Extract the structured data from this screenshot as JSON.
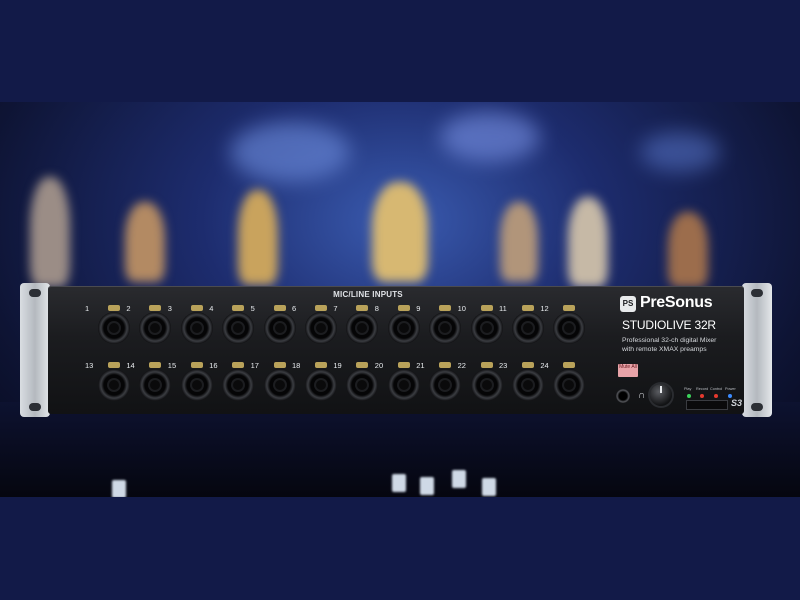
{
  "mixer": {
    "inputs_label": "MIC/LINE INPUTS",
    "row1_numbers": [
      "1",
      "2",
      "3",
      "4",
      "5",
      "6",
      "7",
      "8",
      "9",
      "10",
      "11",
      "12"
    ],
    "row2_numbers": [
      "13",
      "14",
      "15",
      "16",
      "17",
      "18",
      "19",
      "20",
      "21",
      "22",
      "23",
      "24"
    ],
    "brand": "PreSonus",
    "model": "STUDIOLIVE 32R",
    "description_line1": "Professional 32-ch digital Mixer",
    "description_line2": "with remote XMAX preamps",
    "mute_label": "Mute All",
    "status_labels": [
      "Play",
      "Record",
      "Control",
      "Power"
    ],
    "s_badge": "S3"
  }
}
